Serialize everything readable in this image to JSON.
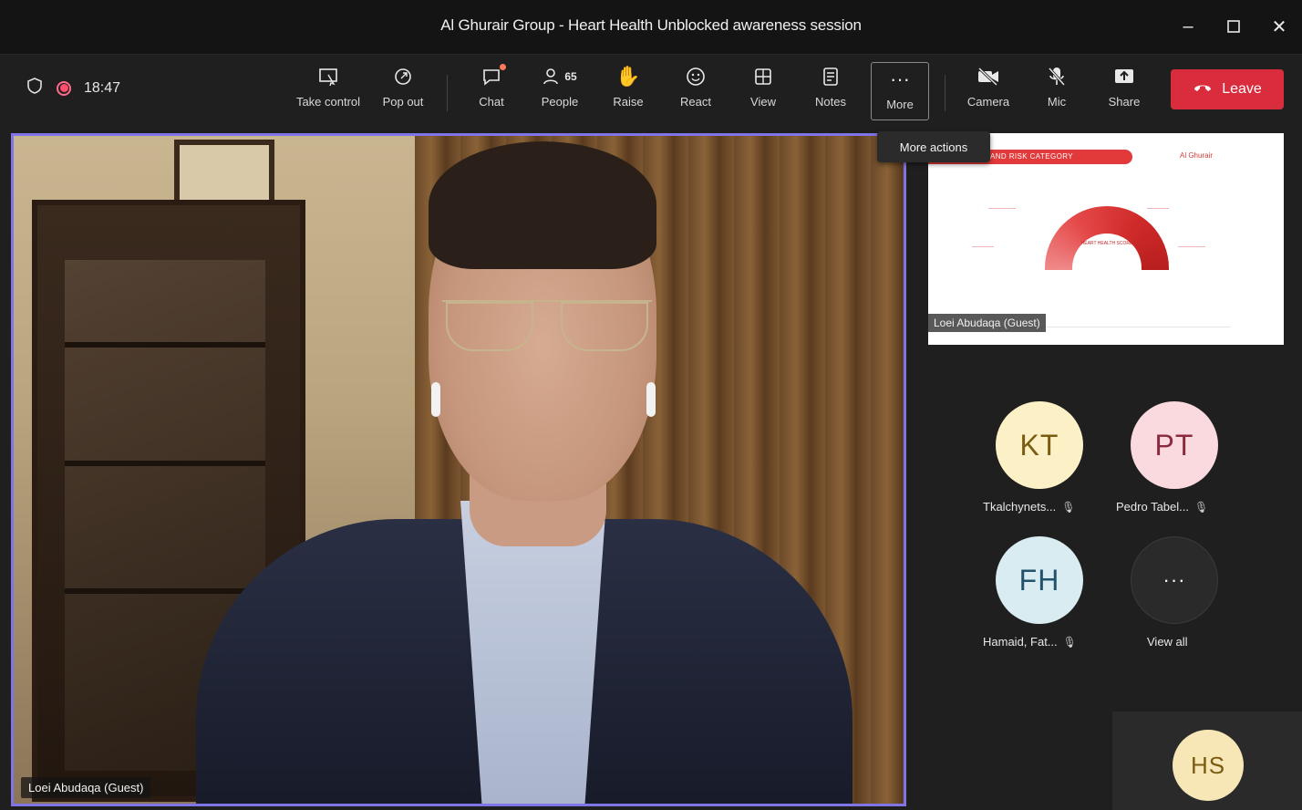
{
  "window": {
    "title": "Al Ghurair Group - Heart Health Unblocked awareness session",
    "min_icon": "minimize-icon",
    "max_icon": "maximize-icon",
    "close_icon": "close-icon"
  },
  "toolbar": {
    "timer": "18:47",
    "take_control": "Take control",
    "pop_out": "Pop out",
    "chat": "Chat",
    "people": "People",
    "people_count": "65",
    "raise": "Raise",
    "react": "React",
    "view": "View",
    "notes": "Notes",
    "more": "More",
    "camera": "Camera",
    "mic": "Mic",
    "share": "Share",
    "leave": "Leave"
  },
  "tooltip": {
    "more_actions": "More actions"
  },
  "main_video": {
    "name": "Loei Abudaqa (Guest)"
  },
  "slide": {
    "band_text": "AND RISK CATEGORY",
    "logo_text": "Al Ghurair",
    "gauge_text": "HEART HEALTH SCORE",
    "name": "Loei Abudaqa (Guest)"
  },
  "participants": [
    {
      "initials": "KT",
      "name": "Tkalchynets...",
      "bg": "#fbf0c6",
      "fg": "#7a5b12"
    },
    {
      "initials": "PT",
      "name": "Pedro Tabel...",
      "bg": "#fad9df",
      "fg": "#8a2a3f"
    },
    {
      "initials": "FH",
      "name": "Hamaid, Fat...",
      "bg": "#d8ecf1",
      "fg": "#23536a"
    }
  ],
  "view_all": {
    "label": "View all"
  },
  "self_view": {
    "initials": "HS",
    "bg": "#f7e7b6",
    "fg": "#7a5b12"
  },
  "colors": {
    "accent": "#7f75e6",
    "leave": "#d92c3c",
    "recording": "#ff4d6d"
  }
}
